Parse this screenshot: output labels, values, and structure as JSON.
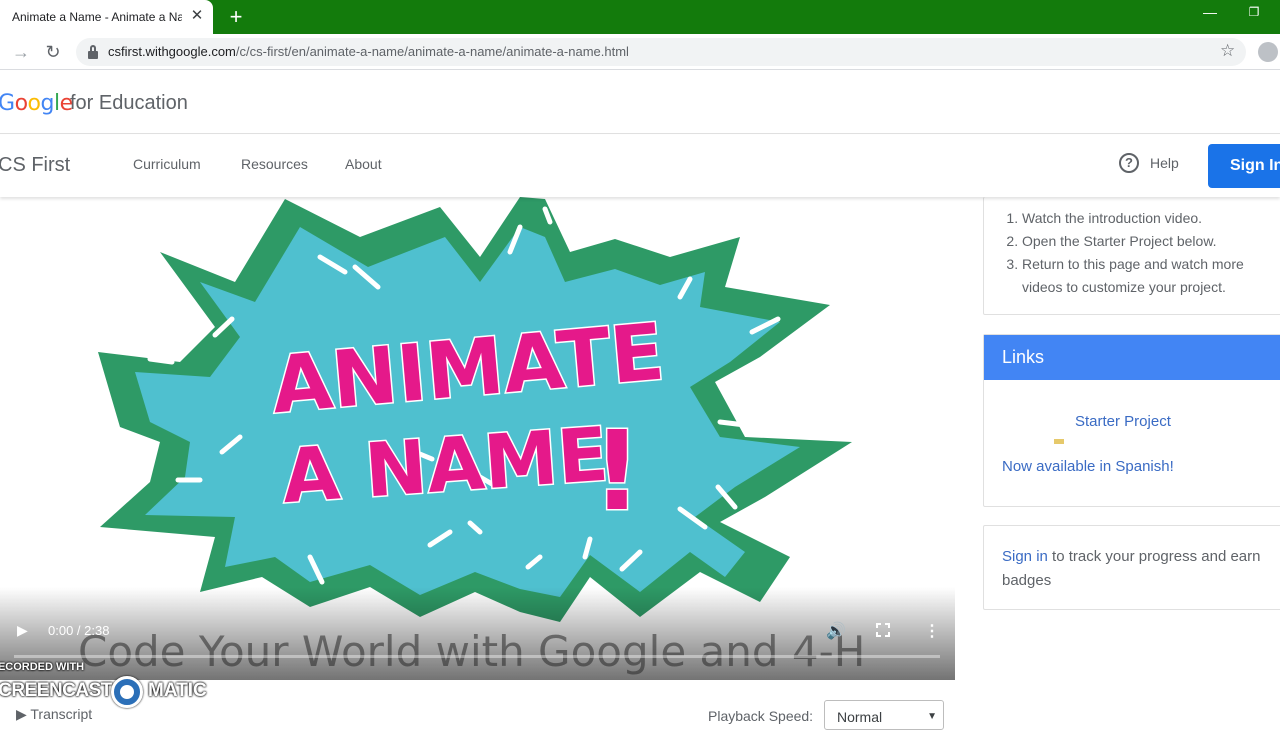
{
  "browser": {
    "tab_title": "Animate a Name - Animate a Na",
    "tab_close": "✕",
    "new_tab": "+",
    "url_host": "csfirst.withgoogle.com",
    "url_path": "/c/cs-first/en/animate-a-name/animate-a-name/animate-a-name.html"
  },
  "header": {
    "logo": {
      "g1": "G",
      "g2": "o",
      "g3": "o",
      "g4": "g",
      "g5": "l",
      "g6": "e"
    },
    "for_education": "for Education"
  },
  "nav": {
    "brand": "CS First",
    "links": [
      "Curriculum",
      "Resources",
      "About"
    ],
    "help": "Help",
    "help_icon_glyph": "?",
    "sign_in": "Sign In"
  },
  "video": {
    "title_line1": "ANIMATE",
    "title_line2": "A NAME",
    "exclaim": "!",
    "caption": "Code Your World with Google and 4-H",
    "time": "0:00 / 2:38",
    "progress": 0.0,
    "watermark_top": "RECORDED WITH",
    "watermark_left": "SCREENCAST",
    "watermark_right": "MATIC"
  },
  "below_video": {
    "transcript": "▶  Transcript",
    "speed_label": "Playback Speed:",
    "speed_value": "Normal"
  },
  "sidebar": {
    "steps": [
      "Watch the introduction video.",
      "Open the Starter Project below.",
      "Return to this page and watch more videos to customize your project."
    ],
    "links_title": "Links",
    "starter_project": "Starter Project",
    "spanish": "Now available in Spanish!",
    "signin_link": "Sign in",
    "signin_rest": " to track your progress and earn badges"
  },
  "colors": {
    "tabbar": "#137b0c",
    "accent_blue": "#1a73e8",
    "links_header": "#4285f4",
    "burst_green": "#2e9a66",
    "burst_teal": "#4fc0cf",
    "title_pink": "#e5198a"
  }
}
